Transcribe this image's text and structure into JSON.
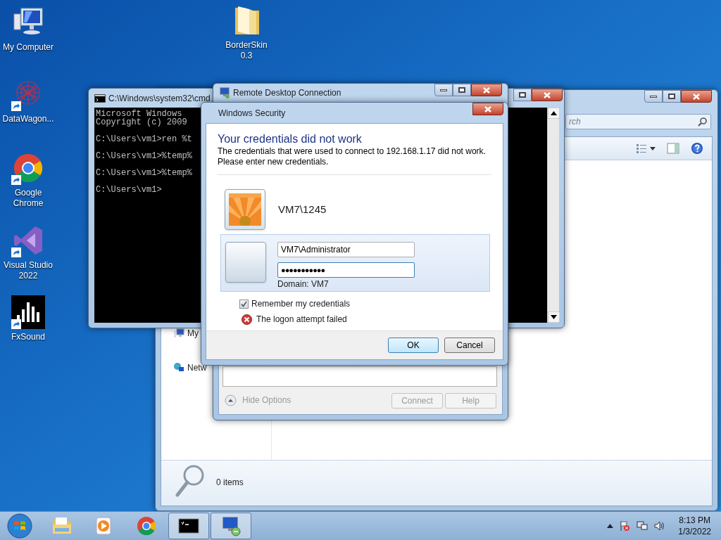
{
  "desktop_icons": [
    {
      "kind": "computer",
      "label": "My Computer",
      "shortcut": false
    },
    {
      "kind": "folder",
      "label": "BorderSkin 0.3",
      "shortcut": false
    },
    {
      "kind": "network-art",
      "label": "DataWagon...",
      "shortcut": true
    },
    {
      "kind": "chrome",
      "label": "Google Chrome",
      "shortcut": true
    },
    {
      "kind": "visual-studio",
      "label": "Visual Studio 2022",
      "shortcut": true
    },
    {
      "kind": "fxsound",
      "label": "FxSound",
      "shortcut": true
    }
  ],
  "explorer": {
    "search": {
      "placeholder": "rch"
    },
    "nav_items": [
      {
        "kind": "computer",
        "label": "My"
      },
      {
        "kind": "network",
        "label": "Netw"
      }
    ],
    "status": "0 items"
  },
  "cmd": {
    "title": "C:\\Windows\\system32\\cmd",
    "lines": [
      "Microsoft Windows",
      "Copyright (c) 2009",
      "C:\\Users\\vm1>ren %t",
      "C:\\Users\\vm1>%temp%",
      "C:\\Users\\vm1>%temp%",
      "C:\\Users\\vm1>"
    ]
  },
  "rdc": {
    "title": "Remote Desktop Connection",
    "hide_options": "Hide Options",
    "buttons": [
      {
        "label": "Connect",
        "disabled": true
      },
      {
        "label": "Help",
        "disabled": true
      }
    ]
  },
  "security": {
    "title": "Windows Security",
    "heading": "Your credentials did not work",
    "message": "The credentials that were used to connect to 192.168.1.17 did not work.\nPlease enter new credentials.",
    "saved_user": "VM7\\1245",
    "username": "VM7\\Administrator",
    "password": "●●●●●●●●●●●",
    "domain": "Domain: VM7",
    "remember": {
      "label": "Remember my credentials",
      "checked": true
    },
    "error": "The logon attempt failed",
    "buttons": [
      {
        "label": "OK",
        "default": true
      },
      {
        "label": "Cancel",
        "default": false
      }
    ]
  },
  "taskbar": {
    "items": [
      {
        "kind": "explorer",
        "active": false
      },
      {
        "kind": "media-player",
        "active": false
      },
      {
        "kind": "chrome",
        "active": false
      },
      {
        "kind": "cmd",
        "active": true
      },
      {
        "kind": "rdc",
        "active": true
      }
    ],
    "time": "8:13 PM",
    "date": "1/3/2022"
  }
}
